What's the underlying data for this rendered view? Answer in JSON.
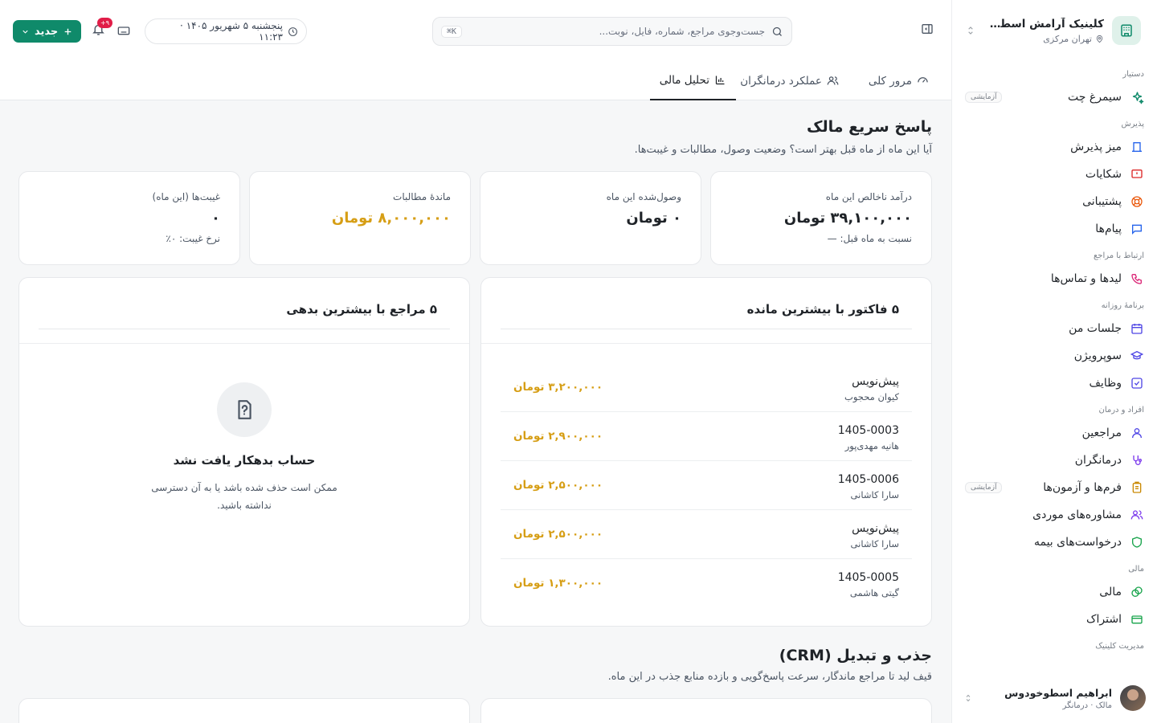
{
  "sidebar": {
    "clinic_name": "کلینیک آرامش اسطوخو...",
    "clinic_location": "تهران مرکزی",
    "groups": [
      {
        "title": "دستیار",
        "items": [
          {
            "label": "سیمرغ چت",
            "badge": "آزمایشی",
            "icon": "sparkles-icon"
          }
        ]
      },
      {
        "title": "پذیرش",
        "items": [
          {
            "label": "میز پذیرش",
            "icon": "desk-icon"
          },
          {
            "label": "شکایات",
            "icon": "alert-message-icon"
          },
          {
            "label": "پشتیبانی",
            "icon": "lifebuoy-icon"
          },
          {
            "label": "پیام‌ها",
            "icon": "message-icon"
          }
        ]
      },
      {
        "title": "ارتباط با مراجع",
        "items": [
          {
            "label": "لیدها و تماس‌ها",
            "icon": "phone-icon"
          }
        ]
      },
      {
        "title": "برنامهٔ روزانه",
        "items": [
          {
            "label": "جلسات من",
            "icon": "calendar-icon"
          },
          {
            "label": "سوپرویژن",
            "icon": "graduation-cap-icon"
          },
          {
            "label": "وظایف",
            "icon": "checkbox-icon"
          }
        ]
      },
      {
        "title": "افراد و درمان",
        "items": [
          {
            "label": "مراجعین",
            "icon": "user-icon"
          },
          {
            "label": "درمانگران",
            "icon": "stethoscope-icon"
          },
          {
            "label": "فرم‌ها و آزمون‌ها",
            "badge": "آزمایشی",
            "icon": "clipboard-icon"
          },
          {
            "label": "مشاوره‌های موردی",
            "icon": "users-icon"
          },
          {
            "label": "درخواست‌های بیمه",
            "icon": "shield-icon"
          }
        ]
      },
      {
        "title": "مالی",
        "items": [
          {
            "label": "مالی",
            "icon": "coins-icon"
          },
          {
            "label": "اشتراک",
            "icon": "credit-card-icon"
          }
        ]
      },
      {
        "title": "مدیریت کلینیک",
        "items": []
      }
    ],
    "user": {
      "name": "ابراهیم اسطوخودوس",
      "role": "مالک · درمانگر"
    }
  },
  "topbar": {
    "search_placeholder": "جست‌وجوی مراجع، شماره، فایل، نوبت...",
    "search_shortcut": "⌘K",
    "datetime": "پنجشنبه ۵ شهریور ۱۴۰۵ · ۱۱:۲۳",
    "notifications_count": "۹+",
    "new_button_label": "جدید"
  },
  "tabs": [
    {
      "label": "مرور کلی",
      "icon": "gauge-icon",
      "active": false
    },
    {
      "label": "عملکرد درمانگران",
      "icon": "users-icon",
      "active": false
    },
    {
      "label": "تحلیل مالی",
      "icon": "bar-chart-icon",
      "active": true
    }
  ],
  "owner_section": {
    "title": "پاسخ سریع مالک",
    "subtitle": "آیا این ماه از ماه قبل بهتر است؟ وضعیت وصول، مطالبات و غیبت‌ها.",
    "kpis": [
      {
        "label": "درآمد ناخالص این ماه",
        "value": "۳۹,۱۰۰,۰۰۰ تومان",
        "sub": "نسبت به ماه قبل: —",
        "tone": "normal"
      },
      {
        "label": "وصول‌شده این ماه",
        "value": "۰ تومان",
        "sub": "",
        "tone": "normal"
      },
      {
        "label": "ماندهٔ مطالبات",
        "value": "۸,۰۰۰,۰۰۰ تومان",
        "sub": "",
        "tone": "warn"
      },
      {
        "label": "غیبت‌ها (این ماه)",
        "value": "۰",
        "sub": "نرخ غیبت: ۰٪",
        "tone": "normal"
      }
    ]
  },
  "top_invoices": {
    "title": "۵ فاکتور با بیشترین مانده",
    "rows": [
      {
        "id": "پیش‌نویس",
        "client": "کیوان محجوب",
        "amount": "۳,۲۰۰,۰۰۰ تومان"
      },
      {
        "id": "1405-0003",
        "client": "هانیه مهدی‌پور",
        "amount": "۲,۹۰۰,۰۰۰ تومان"
      },
      {
        "id": "1405-0006",
        "client": "سارا کاشانی",
        "amount": "۲,۵۰۰,۰۰۰ تومان"
      },
      {
        "id": "پیش‌نویس",
        "client": "سارا کاشانی",
        "amount": "۲,۵۰۰,۰۰۰ تومان"
      },
      {
        "id": "1405-0005",
        "client": "گیتی هاشمی",
        "amount": "۱,۳۰۰,۰۰۰ تومان"
      }
    ]
  },
  "top_debtors": {
    "title": "۵ مراجع با بیشترین بدهی",
    "empty_title": "حساب بدهکار یافت نشد",
    "empty_desc": "ممکن است حذف شده باشد یا به آن دسترسی نداشته باشید."
  },
  "crm_section": {
    "title": "جذب و تبدیل (CRM)",
    "subtitle": "قیف لید تا مراجع ماندگار، سرعت پاسخ‌گویی و بازده منابع جذب در این ماه."
  },
  "colors": {
    "primary": "#0f8a6a",
    "warning": "#d69e15",
    "danger": "#e11d48"
  }
}
